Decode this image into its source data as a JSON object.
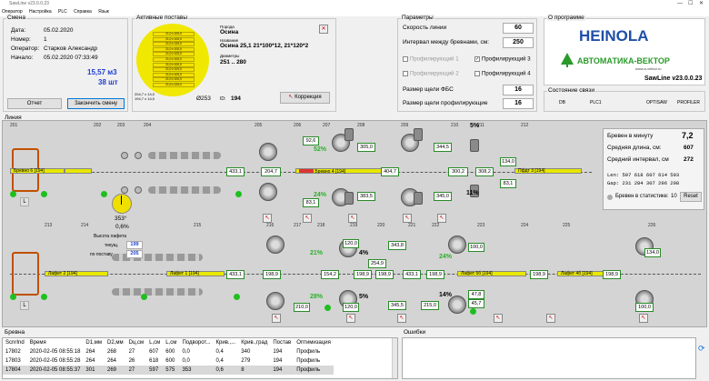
{
  "window": {
    "title": "SawLine v23.0.0.23"
  },
  "menu": [
    "Оператор",
    "Настройка",
    "PLC",
    "Справка",
    "Язык"
  ],
  "shift": {
    "group_title": "Смена",
    "date_label": "Дата:",
    "date": "05.02.2020",
    "number_label": "Номер:",
    "number": "1",
    "operator_label": "Оператор:",
    "operator": "Старков Александр",
    "start_label": "Начало:",
    "start": "05.02.2020 07:33:49",
    "volume": "15,57 м3",
    "count": "38 шт",
    "report_button": "Отчет",
    "end_shift_button": "Закончить смену"
  },
  "active_setups": {
    "group_title": "Активные поставы",
    "period_label": "Порода",
    "period": "Осина",
    "name_label": "Название",
    "name": "Осина 25,1 21*100*12, 21*120*2",
    "diam_label": "Диаметры",
    "diam": "251 .. 280",
    "diameter_symbol": "Ø253",
    "id_label": "ID:",
    "id": "194",
    "correction_button": "Коррекция",
    "pattern_cells": [
      "21,0 x 100,0",
      "21,0 x 100,0",
      "21,0 x 120,0",
      "21,0 x 100,0",
      "21,0 x 100,0",
      "21,0 x 100,0",
      "21,0 x 100,0",
      "21,0 x 100,0",
      "21,0 x 100,0",
      "21,0 x 100,0",
      "21,0 x 120,0"
    ],
    "side_labels": [
      "204,7 x 14,0",
      "194,7 x 14,0"
    ]
  },
  "params": {
    "group_title": "Параметры",
    "speed_label": "Скорость линии",
    "speed": "60",
    "interval_label": "Интервал между бревнами, см:",
    "interval": "250",
    "profiler1": "Профилирующий 1",
    "profiler2": "Профилирующий 2",
    "profiler3": "Профилирующий 3",
    "profiler4": "Профилирующий 4",
    "fbs_label": "Размер щели ФБС",
    "fbs": "16",
    "prof_gap_label": "Размер щели профилирующие",
    "prof_gap": "16"
  },
  "about": {
    "group_title": "О программе",
    "brand1": "HEINOLA",
    "brand2": "АВТОМАТИКА-ВЕКТОР",
    "brand2_url": "www.a-vektor.ru",
    "version": "SawLine v23.0.0.23"
  },
  "connection": {
    "group_title": "Состояние связи",
    "items": [
      "DB",
      "PLC1",
      "OPTISAW",
      "PROFILER"
    ]
  },
  "line": {
    "group_title": "Линия",
    "section_numbers_top": [
      "201",
      "202",
      "203",
      "204",
      "205",
      "206",
      "207",
      "208",
      "209",
      "210",
      "211",
      "212"
    ],
    "section_numbers_bottom": [
      "213",
      "214",
      "215",
      "216",
      "217",
      "218",
      "219",
      "220",
      "221",
      "222",
      "223",
      "224",
      "225",
      "226"
    ],
    "belts": {
      "log6": "Бревно 6",
      "log6_id": "[194]",
      "log4": "Бревно 4",
      "log4_id": "[194]",
      "bundle3": "Пфдт 3",
      "bundle3_id": "[194]",
      "bundle2": "Лафет 2",
      "bundle2_id": "[194]",
      "bundle1": "Лафет 1",
      "bundle1_id": "[194]",
      "bundle5b": "Лафет 5б",
      "bundle5b_id": "[194]",
      "bundle4b": "Лафет 4б",
      "bundle4b_id": "[194]"
    },
    "boxes_top": [
      "433,1",
      "204,7",
      "92,6",
      "83,1",
      "305,0",
      "383,5",
      "404,7",
      "344,5",
      "300,2",
      "134,0",
      "83,1",
      "345,0",
      "308,2"
    ],
    "boxes_bottom": [
      "120,0",
      "254,9",
      "343,8",
      "433,1",
      "198,9",
      "154,2",
      "198,9",
      "198,9",
      "433,1",
      "198,9",
      "198,9",
      "210,0",
      "345,5",
      "215,0",
      "134,0",
      "120,0",
      "47,8",
      "45,7",
      "100,0",
      "198,9",
      "100,0"
    ],
    "pct_green": [
      "52%",
      "24%",
      "21%",
      "28%",
      "24%"
    ],
    "pct_black": [
      "5%",
      "11%",
      "4%",
      "5%",
      "14%"
    ],
    "angle": "353°",
    "angle_pct": "0,6%",
    "lafet_height_label": "Высота лафета",
    "current_label": "текущ.",
    "current": "199",
    "by_setup_label": "по поставу",
    "by_setup": "205",
    "side_button": "L",
    "stats": {
      "logs_per_min_label": "Бревен в минуту",
      "logs_per_min": "7,2",
      "avg_length_label": "Средняя длина, см:",
      "avg_length": "607",
      "avg_interval_label": "Средний интервал, см",
      "avg_interval": "272",
      "len_row": "Len: 597 618 607 614 593",
      "gap_row": "Gap: 231 284 307 296 298",
      "in_stats_label": "Бревен в статистике:",
      "in_stats": "10",
      "reset_button": "Reset"
    }
  },
  "logs_table": {
    "group_title": "Бревна",
    "columns": [
      "ScnrInd",
      "Время",
      "D1,мм",
      "D2,мм",
      "Dц,см",
      "L,см",
      "L,см",
      "Подворот...",
      "Крив.,...",
      "Крив.,град",
      "Постав",
      "Оптимизация"
    ],
    "rows": [
      [
        "17802",
        "2020-02-05 08:55:18",
        "264",
        "268",
        "27",
        "607",
        "600",
        "0,0",
        "0,4",
        "340",
        "194",
        "Профиль"
      ],
      [
        "17803",
        "2020-02-05 08:55:28",
        "264",
        "264",
        "26",
        "618",
        "600",
        "0,0",
        "0,4",
        "279",
        "194",
        "Профиль"
      ],
      [
        "17804",
        "2020-02-05 08:55:37",
        "301",
        "269",
        "27",
        "597",
        "575",
        "353",
        "0,6",
        "8",
        "194",
        "Профиль"
      ]
    ]
  },
  "errors": {
    "group_title": "Ошибки"
  },
  "colors": {
    "green": "#1fbf1f",
    "yellow": "#e8e800",
    "brand_blue": "#1f4fa8",
    "brand_green": "#2a9a2a"
  }
}
